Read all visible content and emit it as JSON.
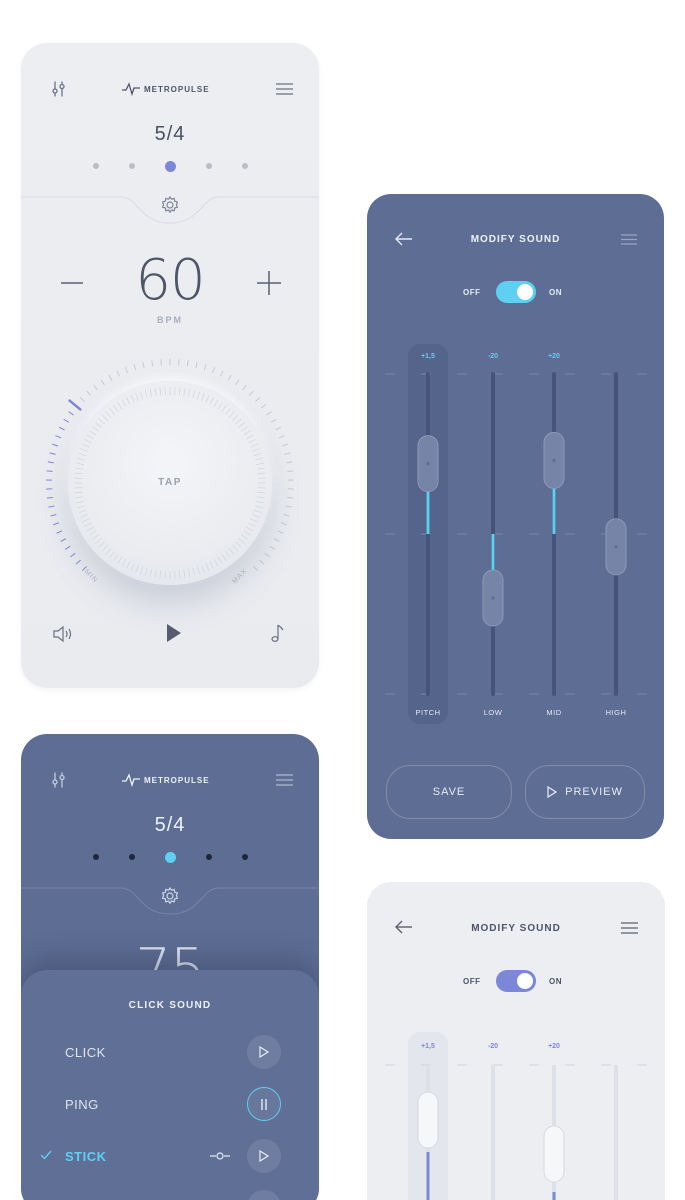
{
  "app": {
    "brand": "METROPULSE"
  },
  "metronome_light": {
    "time_signature": "5/4",
    "bpm": "60",
    "bpm_label": "BPM",
    "tap_label": "TAP",
    "min_label": "MIN",
    "max_label": "MAX",
    "accent": "#7d87d8"
  },
  "modify_sound_dark": {
    "title": "MODIFY SOUND",
    "toggle_off": "OFF",
    "toggle_on": "ON",
    "sliders": [
      {
        "label": "PITCH",
        "value_label": "+1,5",
        "value": 0.72
      },
      {
        "label": "LOW",
        "value_label": "-20",
        "value": 0.3
      },
      {
        "label": "MID",
        "value_label": "+20",
        "value": 0.73
      },
      {
        "label": "HIGH",
        "value_label": "",
        "value": 0.46
      }
    ],
    "save_label": "SAVE",
    "preview_label": "PREVIEW",
    "accent": "#5fd0f2"
  },
  "metronome_dark": {
    "time_signature": "5/4",
    "bpm_partial": "75",
    "click_sound": {
      "title": "CLICK SOUND",
      "items": [
        {
          "label": "CLICK",
          "selected": false,
          "state": "play"
        },
        {
          "label": "PING",
          "selected": false,
          "state": "pause"
        },
        {
          "label": "STICK",
          "selected": true,
          "state": "play"
        }
      ]
    }
  },
  "modify_sound_light": {
    "title": "MODIFY SOUND",
    "toggle_off": "OFF",
    "toggle_on": "ON",
    "value_labels": [
      "+1,5",
      "-20",
      "+20"
    ],
    "accent": "#7d87d8"
  }
}
